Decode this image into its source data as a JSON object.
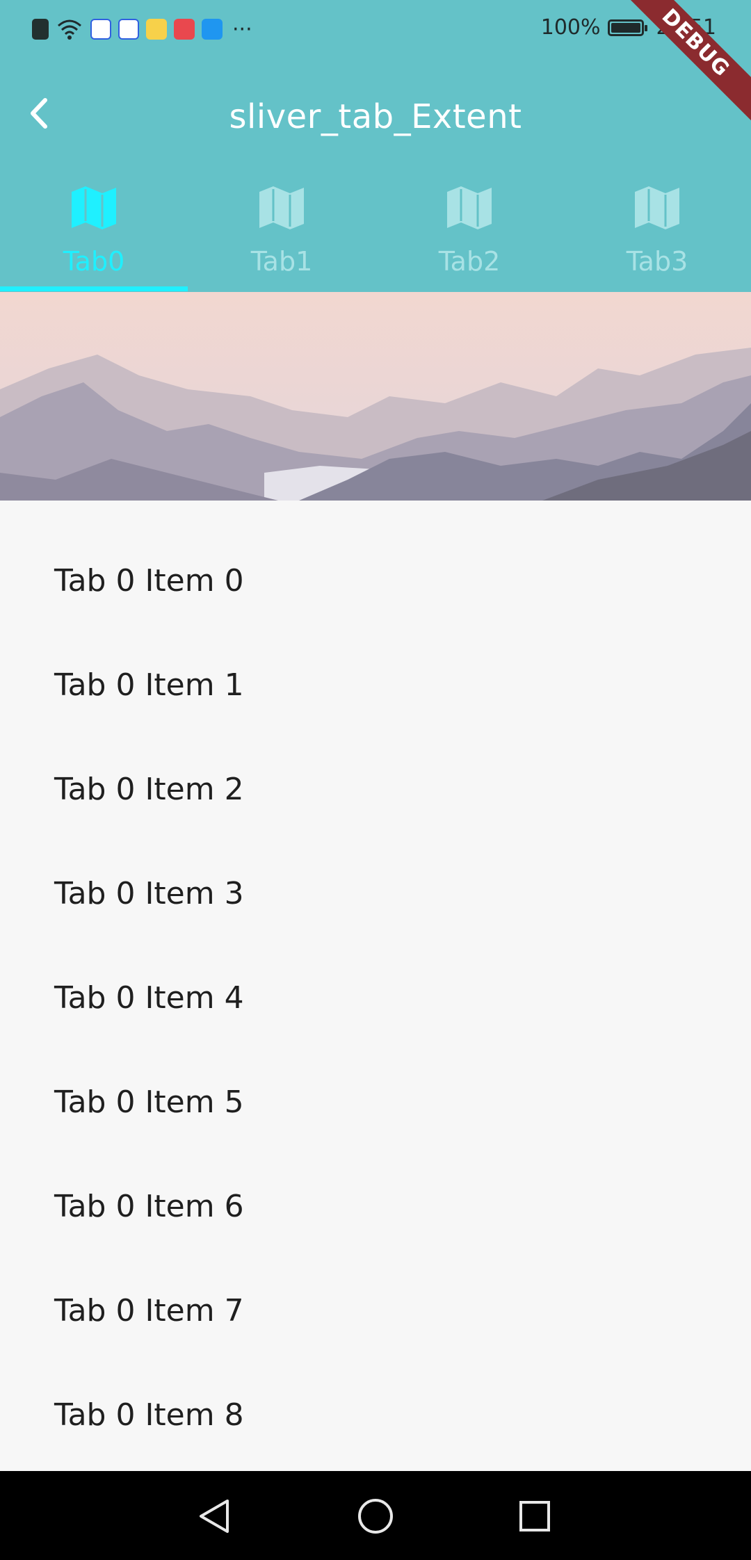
{
  "status_bar": {
    "battery_percent": "100%",
    "time": "22:51",
    "more_icons": "···",
    "notification_icons": [
      "alert-icon",
      "wifi-icon",
      "baidu-icon",
      "baidu-icon",
      "weibo-icon",
      "huawei-icon",
      "search-icon"
    ]
  },
  "app_bar": {
    "title": "sliver_tab_Extent",
    "back_icon": "chevron-left-icon"
  },
  "tabs": [
    {
      "label": "Tab0",
      "icon": "map-icon",
      "active": true
    },
    {
      "label": "Tab1",
      "icon": "map-icon",
      "active": false
    },
    {
      "label": "Tab2",
      "icon": "map-icon",
      "active": false
    },
    {
      "label": "Tab3",
      "icon": "map-icon",
      "active": false
    }
  ],
  "list": {
    "items": [
      "Tab 0 Item 0",
      "Tab 0 Item 1",
      "Tab 0 Item 2",
      "Tab 0 Item 3",
      "Tab 0 Item 4",
      "Tab 0 Item 5",
      "Tab 0 Item 6",
      "Tab 0 Item 7",
      "Tab 0 Item 8"
    ]
  },
  "debug_banner": "DEBUG",
  "colors": {
    "app_bar": "#64c2c8",
    "active_tab": "#1ff0ff",
    "inactive_tab": "#a8e2e5",
    "debug_ribbon": "#8b2b2f"
  }
}
